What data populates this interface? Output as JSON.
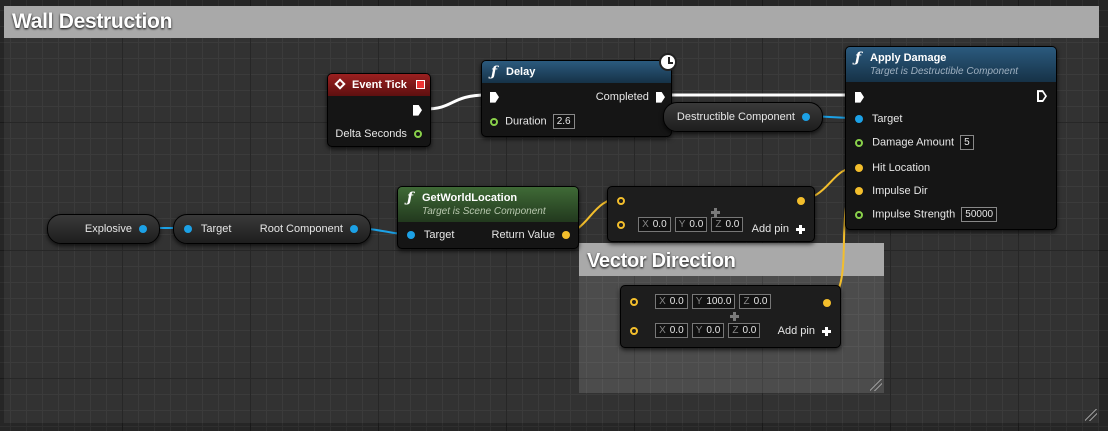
{
  "comments": {
    "wall_destruction": "Wall Destruction",
    "vector_direction": "Vector Direction"
  },
  "colors": {
    "exec_wire": "#ffffff",
    "object_pin": "#1ca1e6",
    "vector_pin": "#f3be2c",
    "float_pin": "#89d04a",
    "event_header": "#8b1a1a",
    "function_header": "#1f4d6e",
    "pure_function_header": "#3b6332"
  },
  "event_tick": {
    "title": "Event Tick",
    "delta_seconds": "Delta Seconds",
    "icon": "event-diamond-icon"
  },
  "delay": {
    "title": "Delay",
    "completed": "Completed",
    "duration_label": "Duration",
    "duration_value": "2.6",
    "icon": "function-icon",
    "latent_icon": "clock-icon"
  },
  "apply_damage": {
    "title": "Apply Damage",
    "subtitle": "Target is Destructible Component",
    "target": "Target",
    "damage_amount_label": "Damage Amount",
    "damage_amount_value": "5",
    "hit_location": "Hit Location",
    "impulse_dir": "Impulse Dir",
    "impulse_strength_label": "Impulse Strength",
    "impulse_strength_value": "50000"
  },
  "destructible_component": {
    "label": "Destructible Component"
  },
  "get_world_location": {
    "title": "GetWorldLocation",
    "subtitle": "Target is Scene Component",
    "target": "Target",
    "return_value": "Return Value"
  },
  "explosive": {
    "label": "Explosive"
  },
  "root_component_getter": {
    "target": "Target",
    "root_component": "Root Component"
  },
  "add_node_1": {
    "x": "0.0",
    "y": "0.0",
    "z": "0.0",
    "add_pin": "Add pin"
  },
  "add_node_2": {
    "row1": {
      "x": "0.0",
      "y": "100.0",
      "z": "0.0"
    },
    "row2": {
      "x": "0.0",
      "y": "0.0",
      "z": "0.0"
    },
    "add_pin": "Add pin"
  },
  "axes": {
    "x": "X",
    "y": "Y",
    "z": "Z"
  }
}
